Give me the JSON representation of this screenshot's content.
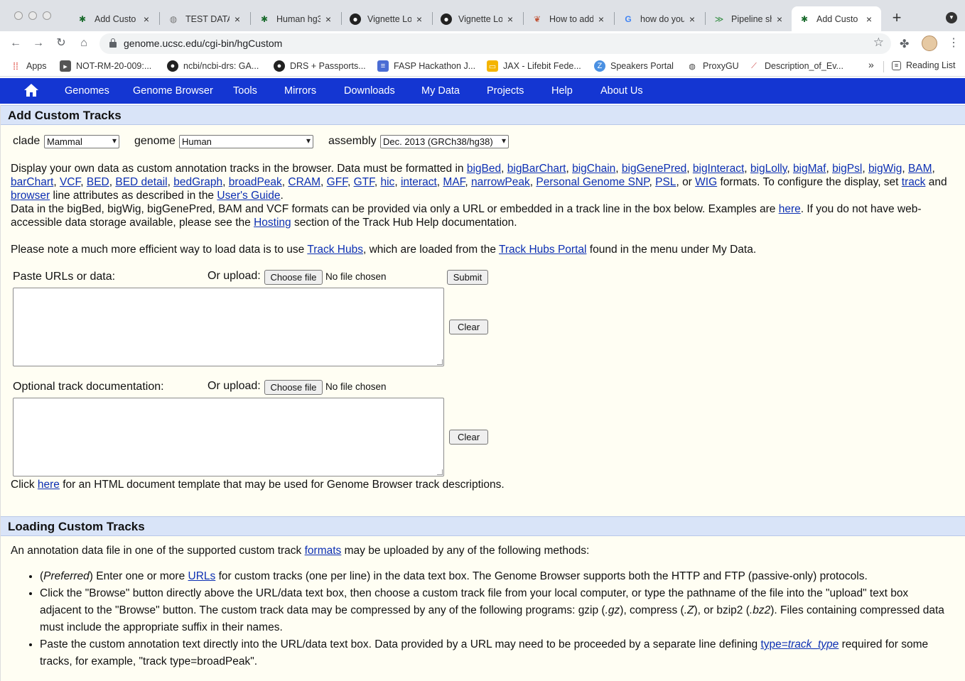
{
  "browser": {
    "tabs": [
      {
        "title": "Add Custo",
        "icon": "ucsc-helix-icon"
      },
      {
        "title": "TEST DATA",
        "icon": "globe-icon"
      },
      {
        "title": "Human hg3",
        "icon": "ucsc-helix-icon"
      },
      {
        "title": "Vignette Lo",
        "icon": "github-icon"
      },
      {
        "title": "Vignette Lo",
        "icon": "github-icon"
      },
      {
        "title": "How to add",
        "icon": "biostars-icon"
      },
      {
        "title": "how do you",
        "icon": "google-icon"
      },
      {
        "title": "Pipeline sh",
        "icon": "pipeline-icon"
      },
      {
        "title": "Add Custo",
        "icon": "ucsc-helix-icon",
        "active": true
      }
    ],
    "close_glyph": "×",
    "new_tab_glyph": "+",
    "url": "genome.ucsc.edu/cgi-bin/hgCustom",
    "bookmarks": [
      {
        "label": "Apps",
        "icon": "apps-grid-icon"
      },
      {
        "label": "NOT-RM-20-009:...",
        "icon": "tag-icon"
      },
      {
        "label": "ncbi/ncbi-drs: GA...",
        "icon": "github-icon"
      },
      {
        "label": "DRS + Passports...",
        "icon": "github-icon"
      },
      {
        "label": "FASP Hackathon J...",
        "icon": "doc-icon"
      },
      {
        "label": "JAX - Lifebit Fede...",
        "icon": "slides-icon"
      },
      {
        "label": "Speakers Portal",
        "icon": "speakers-icon"
      },
      {
        "label": "ProxyGU",
        "icon": "globe-icon"
      },
      {
        "label": "Description_of_Ev...",
        "icon": "chart-icon"
      }
    ],
    "more_bookmarks": "»",
    "reading_list": "Reading List"
  },
  "nav": {
    "items": [
      "Genomes",
      "Genome Browser",
      "Tools",
      "Mirrors",
      "Downloads",
      "My Data",
      "Projects",
      "Help",
      "About Us"
    ]
  },
  "add_tracks": {
    "heading": "Add Custom Tracks",
    "clade_label": "clade",
    "clade_value": "Mammal",
    "genome_label": "genome",
    "genome_value": "Human",
    "assembly_label": "assembly",
    "assembly_value": "Dec. 2013 (GRCh38/hg38)",
    "intro_1": "Display your own data as custom annotation tracks in the browser. Data must be formatted in",
    "format_links": [
      "bigBed",
      "bigBarChart",
      "bigChain",
      "bigGenePred",
      "bigInteract",
      "bigLolly",
      "bigMaf",
      "bigPsl",
      "bigWig",
      "BAM",
      "barChart",
      "VCF",
      "BED",
      "BED detail",
      "bedGraph",
      "broadPeak",
      "CRAM",
      "GFF",
      "GTF",
      "hic",
      "interact",
      "MAF",
      "narrowPeak",
      "Personal Genome SNP",
      "PSL",
      "WIG"
    ],
    "or_word": "or",
    "intro_2": "formats. To configure the display, set",
    "track_link": "track",
    "and_word": "and",
    "browser_link": "browser",
    "intro_3": "line attributes as described in the",
    "users_guide_link": "User's Guide",
    "period": ".",
    "bigdata_text": "Data in the bigBed, bigWig, bigGenePred, BAM and VCF formats can be provided via only a URL or embedded in a track line in the box below. Examples are",
    "here_link": "here",
    "bigdata_text_2": ". If you do not have web-accessible data storage available, please see the",
    "hosting_link": "Hosting",
    "bigdata_text_3": "section of the Track Hub Help documentation.",
    "note_1": "Please note a much more efficient way to load data is to use",
    "track_hubs_link": "Track Hubs",
    "note_2": ", which are loaded from the",
    "portal_link": "Track Hubs Portal",
    "note_3": "found in the menu under My Data.",
    "paste_label": "Paste URLs or data:",
    "upload_label": "Or upload:",
    "choose_file": "Choose file",
    "no_file": "No file chosen",
    "submit": "Submit",
    "clear": "Clear",
    "doc_label": "Optional track documentation:",
    "click_text": "Click",
    "click_here_link": "here",
    "click_rest": "for an HTML document template that may be used for Genome Browser track descriptions."
  },
  "loading": {
    "heading": "Loading Custom Tracks",
    "intro": "An annotation data file in one of the supported custom track",
    "formats_link": "formats",
    "intro_rest": "may be uploaded by any of the following methods:",
    "b1_open": "(",
    "b1_pref": "Preferred",
    "b1_close": ") Enter one or more",
    "b1_link": "URLs",
    "b1_rest": "for custom tracks (one per line) in the data text box. The Genome Browser supports both the HTTP and FTP (passive-only) protocols.",
    "b2_text": "Click the \"Browse\" button directly above the URL/data text box, then choose a custom track file from your local computer, or type the pathname of the file into the \"upload\" text box adjacent to the \"Browse\" button. The custom track data may be compressed by any of the following programs: gzip (",
    "b2_gz": ".gz",
    "b2_mid": "), compress (",
    "b2_z": ".Z",
    "b2_mid2": "), or bzip2 (",
    "b2_bz2": ".bz2",
    "b2_end": "). Files containing compressed data must include the appropriate suffix in their names.",
    "b3_text": "Paste the custom annotation text directly into the URL/data text box. Data provided by a URL may need to be proceeded by a separate line defining",
    "b3_link_a": "type=",
    "b3_link_b": "track_type",
    "b3_rest": "required for some tracks, for example, \"track type=broadPeak\"."
  }
}
